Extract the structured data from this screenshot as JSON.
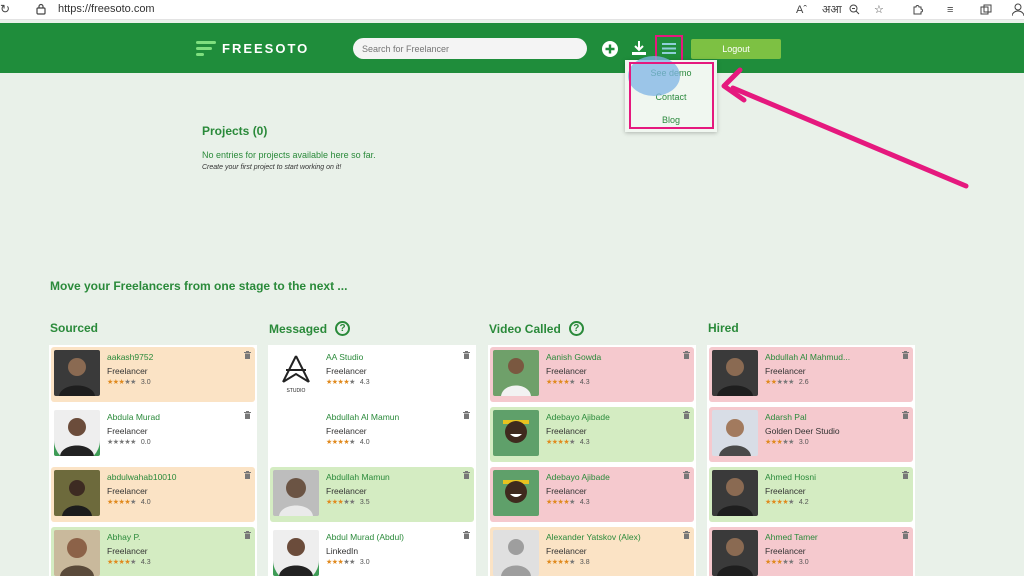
{
  "browser": {
    "url": "https://freesoto.com"
  },
  "header": {
    "logo_text": "FREESOTO",
    "search_placeholder": "Search for Freelancer",
    "logout_label": "Logout"
  },
  "menu": {
    "items": [
      {
        "label": "See demo"
      },
      {
        "label": "Contact"
      },
      {
        "label": "Blog"
      }
    ]
  },
  "projects": {
    "title": "Projects (0)",
    "empty_text": "No entries for projects available here so far.",
    "hint": "Create your first project to start working on it!"
  },
  "pipeline": {
    "heading": "Move your Freelancers from one stage to the next ...",
    "columns": [
      {
        "title": "Sourced",
        "cards": [
          {
            "name": "aakash9752",
            "role": "Freelancer",
            "rating": "3.0",
            "color": "orange",
            "avatar": "dark"
          },
          {
            "name": "Abdula Murad",
            "role": "Freelancer",
            "rating": "0.0",
            "color": "white",
            "avatar": "green"
          },
          {
            "name": "abdulwahab10010",
            "role": "Freelancer",
            "rating": "4.0",
            "color": "orange",
            "avatar": "olive"
          },
          {
            "name": "Abhay P.",
            "role": "Freelancer",
            "rating": "4.3",
            "color": "green",
            "avatar": "tan"
          }
        ]
      },
      {
        "title": "Messaged",
        "cards": [
          {
            "name": "AA Studio",
            "role": "Freelancer",
            "rating": "4.3",
            "color": "white",
            "avatar": "logo"
          },
          {
            "name": "Abdullah Al Mamun",
            "role": "Freelancer",
            "rating": "4.0",
            "color": "white",
            "avatar": "none"
          },
          {
            "name": "Abdullah Mamun",
            "role": "Freelancer",
            "rating": "3.5",
            "color": "green",
            "avatar": "grey"
          },
          {
            "name": "Abdul Murad (Abdul)",
            "role": "LinkedIn",
            "rating": "3.0",
            "color": "white",
            "avatar": "green"
          }
        ]
      },
      {
        "title": "Video Called",
        "cards": [
          {
            "name": "Aanish Gowda",
            "role": "Freelancer",
            "rating": "4.3",
            "color": "pink",
            "avatar": "outdoor"
          },
          {
            "name": "Adebayo Ajibade",
            "role": "Freelancer",
            "rating": "4.3",
            "color": "green",
            "avatar": "smile"
          },
          {
            "name": "Adebayo Ajibade",
            "role": "Freelancer",
            "rating": "4.3",
            "color": "pink",
            "avatar": "smile"
          },
          {
            "name": "Alexander Yatskov (Alex)",
            "role": "Freelancer",
            "rating": "3.8",
            "color": "orange",
            "avatar": "placeholder"
          }
        ]
      },
      {
        "title": "Hired",
        "cards": [
          {
            "name": "Abdullah Al Mahmud...",
            "role": "Freelancer",
            "rating": "2.6",
            "color": "pink",
            "avatar": "dark"
          },
          {
            "name": "Adarsh Pal",
            "role": "Golden Deer Studio",
            "rating": "3.0",
            "color": "pink",
            "avatar": "light"
          },
          {
            "name": "Ahmed Hosni",
            "role": "Freelancer",
            "rating": "4.2",
            "color": "green",
            "avatar": "dark"
          },
          {
            "name": "Ahmed Tamer",
            "role": "Freelancer",
            "rating": "3.0",
            "color": "pink",
            "avatar": "dark"
          }
        ]
      }
    ]
  },
  "colors": {
    "brand_green": "#1f8d3b",
    "accent_green": "#7dc143",
    "annotation_pink": "#e5197e"
  }
}
